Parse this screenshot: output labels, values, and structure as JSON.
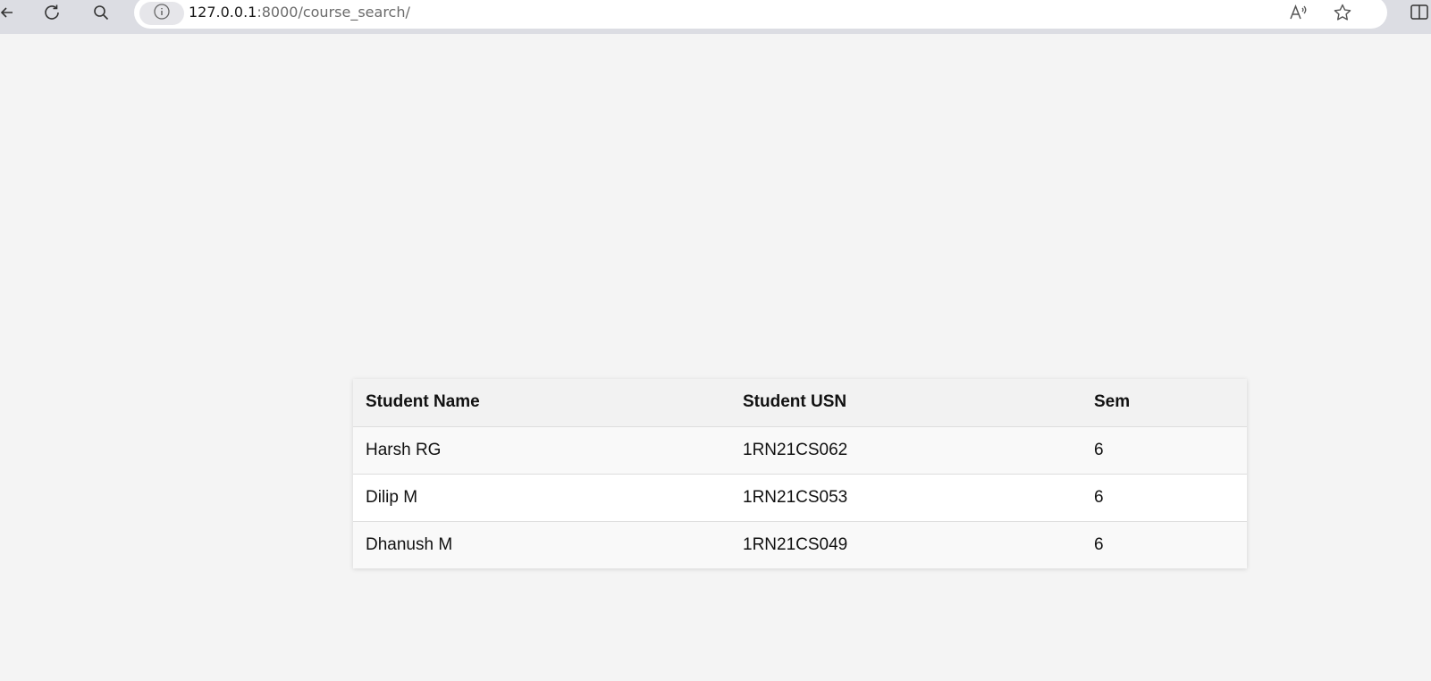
{
  "browser": {
    "url_host": "127.0.0.1",
    "url_path": ":8000/course_search/",
    "icons": {
      "back": "back-arrow-icon",
      "refresh": "refresh-icon",
      "search": "search-icon",
      "site_info": "info-icon",
      "read_aloud": "read-aloud-icon",
      "favorite": "star-icon",
      "split_screen": "split-screen-icon"
    }
  },
  "table": {
    "headers": [
      "Student Name",
      "Student USN",
      "Sem"
    ],
    "rows": [
      {
        "name": "Harsh RG",
        "usn": "1RN21CS062",
        "sem": "6"
      },
      {
        "name": "Dilip M",
        "usn": "1RN21CS053",
        "sem": "6"
      },
      {
        "name": "Dhanush M",
        "usn": "1RN21CS049",
        "sem": "6"
      }
    ]
  },
  "colors": {
    "page_background": "#f4f4f4",
    "header_row_background": "#f2f2f2",
    "stripe_background": "#f9f9f9",
    "toolbar_background": "#dcdde3"
  }
}
